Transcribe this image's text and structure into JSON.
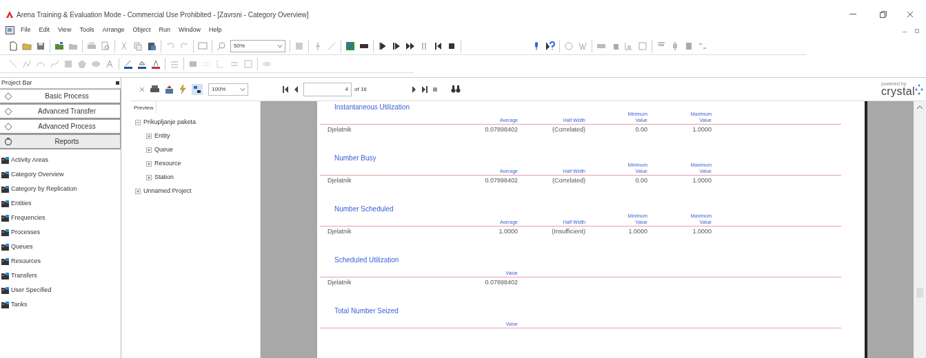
{
  "window": {
    "title": "Arena Training & Evaluation Mode - Commercial Use Prohibited - [Zavrsni - Category Overview]"
  },
  "menu": [
    "File",
    "Edit",
    "View",
    "Tools",
    "Arrange",
    "Object",
    "Run",
    "Window",
    "Help"
  ],
  "toolbar": {
    "zoom": "50%"
  },
  "project_bar": {
    "title": "Project Bar",
    "panels": [
      {
        "label": "Basic Process",
        "expanded": false
      },
      {
        "label": "Advanced Transfer",
        "expanded": false
      },
      {
        "label": "Advanced Process",
        "expanded": false
      },
      {
        "label": "Reports",
        "expanded": true
      }
    ],
    "reports": [
      "Activity Areas",
      "Category Overview",
      "Category by Replication",
      "Entities",
      "Frequencies",
      "Processes",
      "Queues",
      "Resources",
      "Transfers",
      "User Specified",
      "Tanks"
    ]
  },
  "viewer": {
    "zoom": "100%",
    "page": "4",
    "page_total": "of 16",
    "tab": "Preview",
    "logo_caption": "powered by",
    "logo": "crystal",
    "tree": [
      {
        "label": "Prikupljanje paketa",
        "expanded": true,
        "children": [
          {
            "label": "Entity",
            "expanded": false
          },
          {
            "label": "Queue",
            "expanded": false
          },
          {
            "label": "Resource",
            "expanded": false
          },
          {
            "label": "Station",
            "expanded": false
          }
        ]
      },
      {
        "label": "Unnamed Project",
        "expanded": false
      }
    ]
  },
  "report": {
    "sections": [
      {
        "title": "Instantaneous Utilization",
        "columns": [
          "",
          "Average",
          "Half Width",
          "Minimum\nValue",
          "Maximum\nValue"
        ],
        "rows": [
          [
            "Djelatnik",
            "0.07898402",
            "(Correlated)",
            "0.00",
            "1.0000"
          ]
        ]
      },
      {
        "title": "Number Busy",
        "columns": [
          "",
          "Average",
          "Half Width",
          "Minimum\nValue",
          "Maximum\nValue"
        ],
        "rows": [
          [
            "Djelatnik",
            "0.07898402",
            "(Correlated)",
            "0.00",
            "1.0000"
          ]
        ]
      },
      {
        "title": "Number Scheduled",
        "columns": [
          "",
          "Average",
          "Half Width",
          "Minimum\nValue",
          "Maximum\nValue"
        ],
        "rows": [
          [
            "Djelatnik",
            "1.0000",
            "(Insufficient)",
            "1.0000",
            "1.0000"
          ]
        ]
      },
      {
        "title": "Scheduled Utilization",
        "columns": [
          "",
          "Value"
        ],
        "rows": [
          [
            "Djelatnik",
            "0.07898402"
          ]
        ]
      },
      {
        "title": "Total Number Seized",
        "columns": [
          "",
          "Value"
        ]
      }
    ]
  }
}
